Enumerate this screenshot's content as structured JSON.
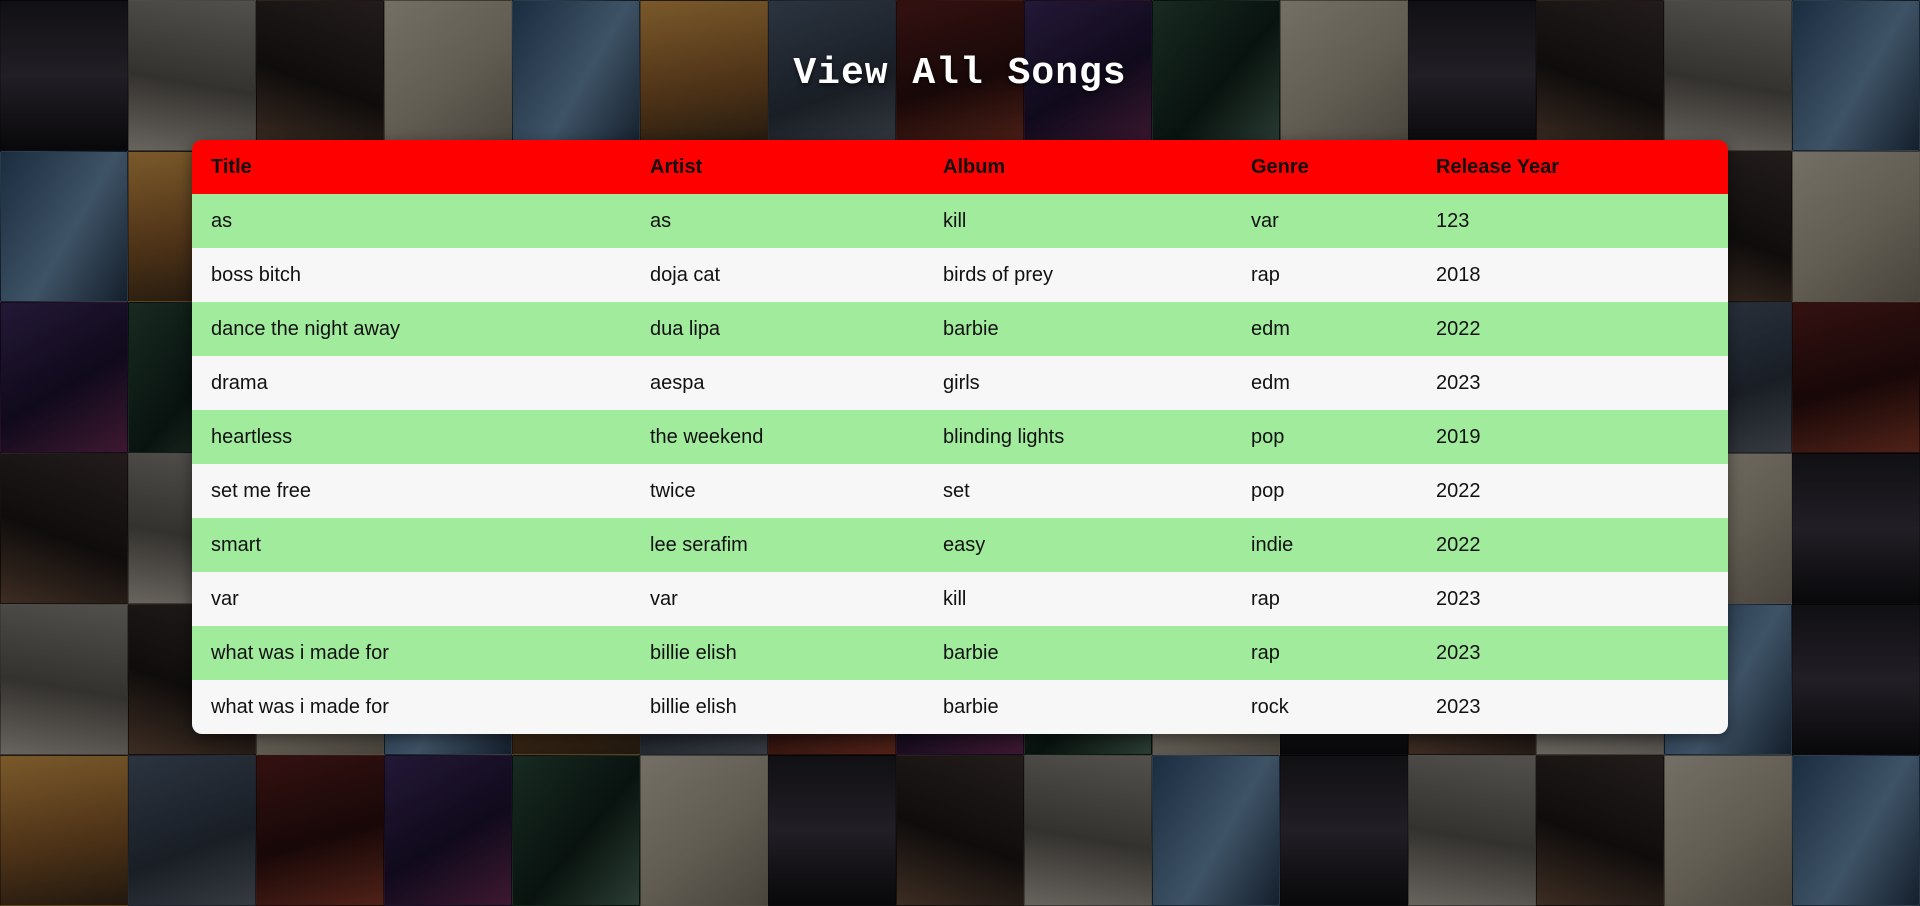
{
  "page": {
    "title": "View All Songs"
  },
  "colors": {
    "header_bg": "#ff0000",
    "row_odd_bg": "#a1eb9d",
    "row_even_bg": "#f7f7f7",
    "title_text": "#ffffff"
  },
  "table": {
    "columns": [
      "Title",
      "Artist",
      "Album",
      "Genre",
      "Release Year"
    ],
    "rows": [
      [
        "as",
        "as",
        "kill",
        "var",
        "123"
      ],
      [
        "boss bitch",
        "doja cat",
        "birds of prey",
        "rap",
        "2018"
      ],
      [
        "dance the night away",
        "dua lipa",
        "barbie",
        "edm",
        "2022"
      ],
      [
        "drama",
        "aespa",
        "girls",
        "edm",
        "2023"
      ],
      [
        "heartless",
        "the weekend",
        "blinding lights",
        "pop",
        "2019"
      ],
      [
        "set me free",
        "twice",
        "set",
        "pop",
        "2022"
      ],
      [
        "smart",
        "lee serafim",
        "easy",
        "indie",
        "2022"
      ],
      [
        "var",
        "var",
        "kill",
        "rap",
        "2023"
      ],
      [
        "what was i made for",
        "billie elish",
        "barbie",
        "rap",
        "2023"
      ],
      [
        "what was i made for",
        "billie elish",
        "barbie",
        "rock",
        "2023"
      ]
    ]
  }
}
